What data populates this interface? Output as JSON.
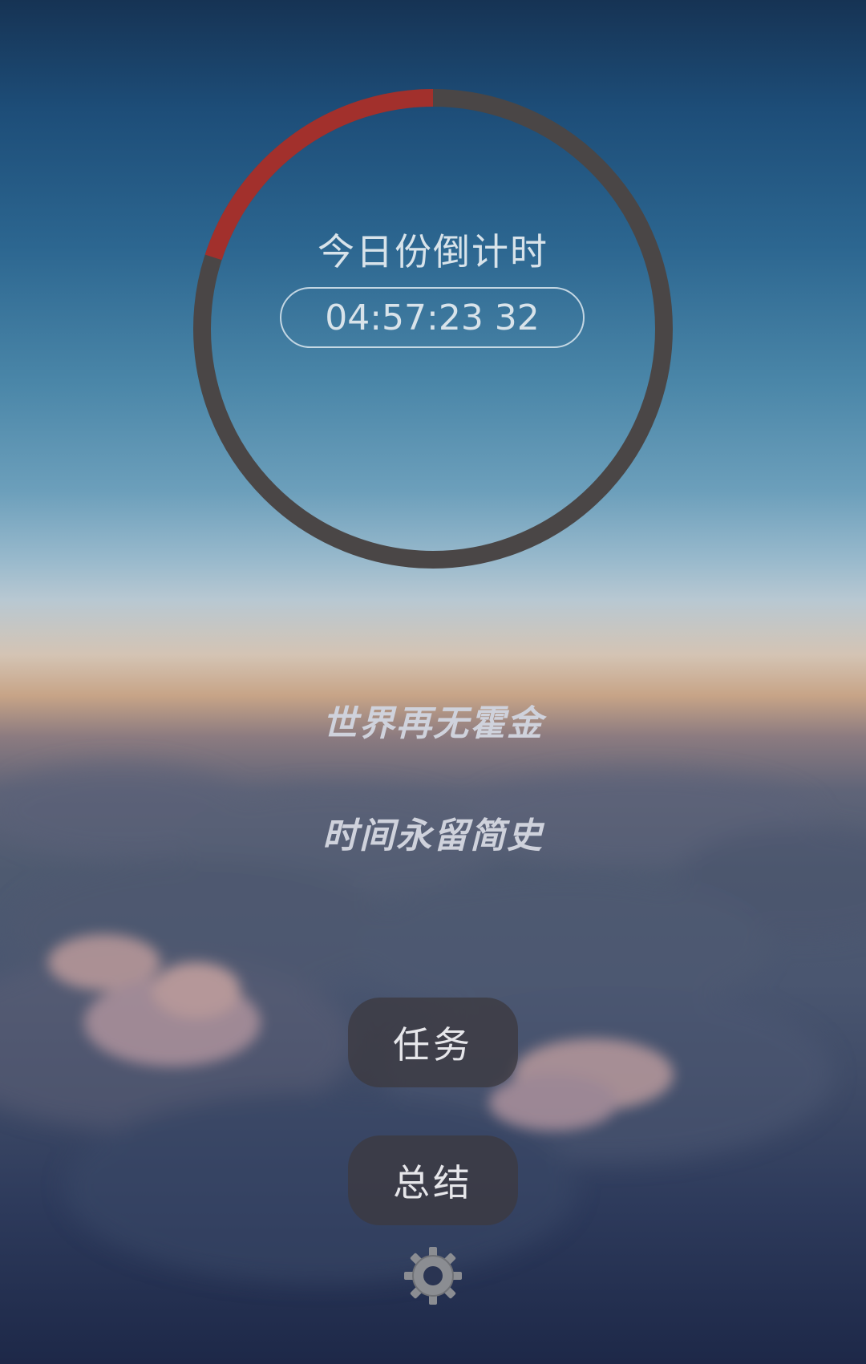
{
  "countdown": {
    "title": "今日份倒计时",
    "time": "04:57:23 32",
    "progress_fraction": 0.2,
    "progress_color": "#a2302c",
    "track_color": "#4a4646"
  },
  "quotes": {
    "line1": "世界再无霍金",
    "line2": "时间永留简史"
  },
  "buttons": {
    "tasks_label": "任务",
    "summary_label": "总结"
  },
  "icons": {
    "settings": "gear-icon"
  }
}
